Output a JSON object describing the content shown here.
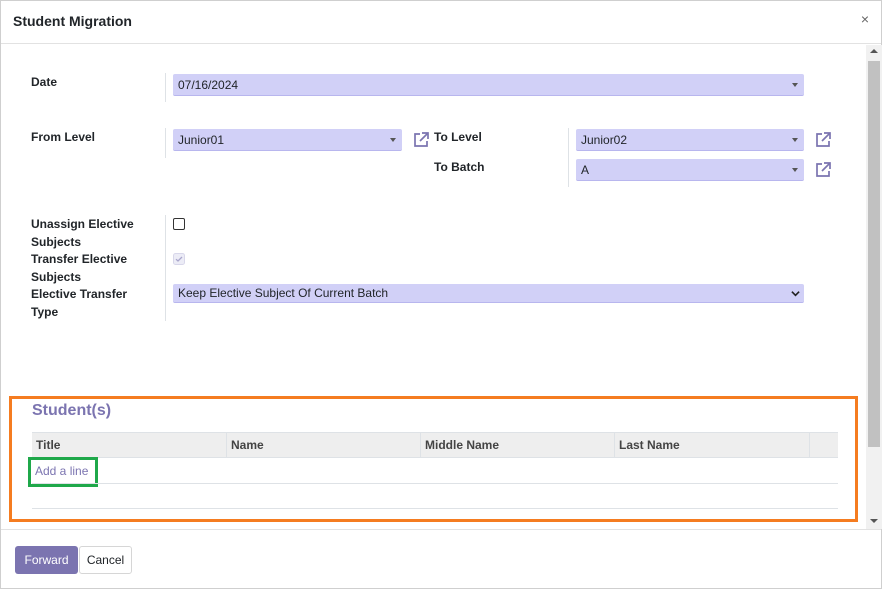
{
  "dialog": {
    "title": "Student Migration",
    "close_glyph": "×"
  },
  "form": {
    "date_label": "Date",
    "date_value": "07/16/2024",
    "from_level_label": "From Level",
    "from_level_value": "Junior01",
    "to_level_label": "To Level",
    "to_level_value": "Junior02",
    "to_batch_label": "To Batch",
    "to_batch_value": "A",
    "unassign_label_1": "Unassign Elective",
    "unassign_label_2": "Subjects",
    "unassign_checked": false,
    "transfer_label_1": "Transfer Elective",
    "transfer_label_2": "Subjects",
    "transfer_checked": true,
    "elective_type_label_1": "Elective Transfer",
    "elective_type_label_2": "Type",
    "elective_type_value": "Keep Elective Subject Of Current Batch"
  },
  "students": {
    "section_title": "Student(s)",
    "columns": [
      "Title",
      "Name",
      "Middle Name",
      "Last Name"
    ],
    "add_line": "Add a line"
  },
  "footer": {
    "forward_label": "Forward",
    "cancel_label": "Cancel"
  },
  "icons": {
    "external_link": "external-link-icon",
    "close": "close-icon",
    "caret": "caret-down-icon"
  },
  "colors": {
    "accent": "#7b74b0",
    "field_bg": "#d1d0f7",
    "highlight_orange": "#f57c20",
    "highlight_green": "#1fa84a"
  }
}
